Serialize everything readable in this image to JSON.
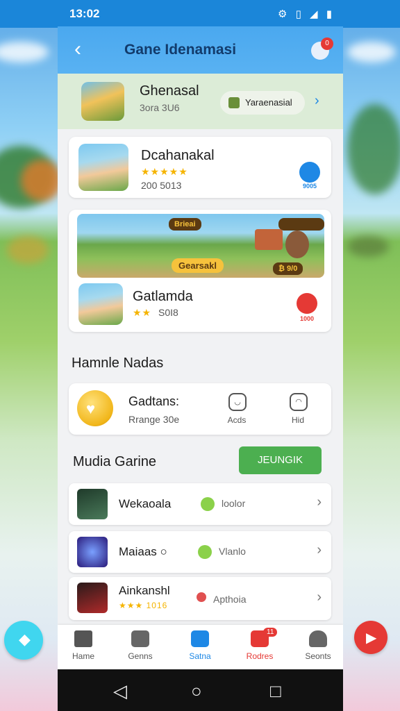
{
  "status": {
    "time": "13:02",
    "icons": "⚙ ▯ ◢ ▮"
  },
  "header": {
    "title": "Gane Idenamasi",
    "badge": "0"
  },
  "featured": {
    "title": "Ghenasal",
    "subtitle": "3ora 3U6",
    "pill_label": "Yaraenasial"
  },
  "card1": {
    "title": "Dcahanakal",
    "stars": "★★★★★",
    "meta": "200 5013",
    "gear_label": "9005"
  },
  "card2": {
    "banner_tags": [
      "Brieai",
      "Gearsakl"
    ],
    "banner_counter": "₿ 9/0",
    "title": "Gatlamda",
    "stars": "★★",
    "meta": "S0I8",
    "gear_label": "1000"
  },
  "section1": {
    "title": "Hamnle Nadas"
  },
  "stats": {
    "title": "Gadtans:",
    "subtitle": "Rrange 30e",
    "item1_label": "Acds",
    "item2_label": "Hid"
  },
  "section2": {
    "title": "Mudia Garine",
    "button": "JEUNGIK"
  },
  "list": [
    {
      "title": "Wekaoala",
      "tag": "loolor"
    },
    {
      "title": "Maiaas ○",
      "tag": "Vlanlo"
    },
    {
      "title": "Ainkanshl",
      "meta": "★★★ 1016",
      "tag": "Apthoia"
    }
  ],
  "nav": {
    "items": [
      {
        "label": "Hame"
      },
      {
        "label": "Genns"
      },
      {
        "label": "Satna"
      },
      {
        "label": "Rodres"
      },
      {
        "label": "Seonts"
      }
    ],
    "badge": "11"
  },
  "colors": {
    "primary": "#1e88e5",
    "accent_green": "#4caf50",
    "danger": "#e53935",
    "star": "#f5b400"
  }
}
